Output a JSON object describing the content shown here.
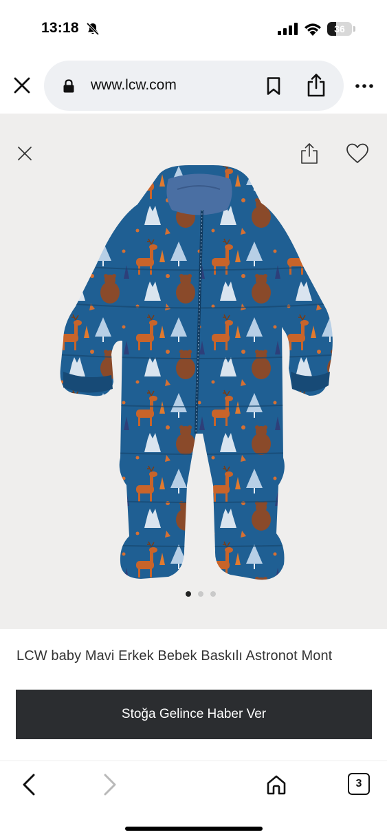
{
  "status_bar": {
    "time": "13:18",
    "battery_level": "36",
    "icons": [
      "bell-slash-icon",
      "signal-icon",
      "wifi-icon",
      "battery-icon"
    ]
  },
  "browser": {
    "url": "www.lcw.com",
    "icons": [
      "close-icon",
      "lock-icon",
      "bookmark-icon",
      "share-icon",
      "more-icon"
    ]
  },
  "gallery": {
    "image_count": 3,
    "active_index": 0,
    "icons": [
      "close-icon",
      "share-icon",
      "heart-icon"
    ],
    "colors": {
      "background": "#efeeed",
      "garment": "#1f5f93"
    }
  },
  "product": {
    "title": "LCW baby Mavi Erkek Bebek Baskılı Astronot Mont"
  },
  "cta": {
    "label": "Stoğa Gelince Haber Ver",
    "color": "#2b2d30"
  },
  "toolbar": {
    "tab_count": "3",
    "icons": [
      "back-icon",
      "forward-icon",
      "home-icon",
      "tabs-icon"
    ]
  }
}
